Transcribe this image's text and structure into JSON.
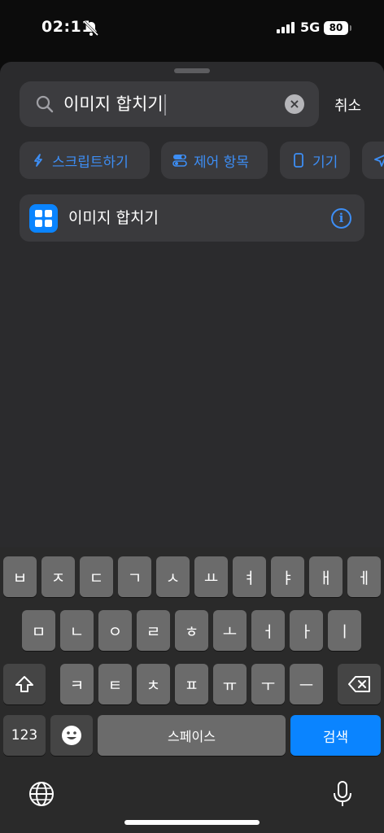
{
  "status": {
    "time": "02:11",
    "network": "5G",
    "battery": "80"
  },
  "search": {
    "query": "이미지 합치기",
    "clear_icon": "x-circle-icon",
    "cancel_label": "취소"
  },
  "chips": [
    {
      "label": "스크립트하기",
      "icon": "script-icon"
    },
    {
      "label": "제어 항목",
      "icon": "toggle-icon"
    },
    {
      "label": "기기",
      "icon": "phone-icon"
    },
    {
      "label": "",
      "icon": "location-arrow-icon"
    }
  ],
  "result": {
    "title": "이미지 합치기",
    "icon": "shortcut-app-icon",
    "info_icon": "info-icon"
  },
  "keyboard": {
    "row1": [
      "ㅂ",
      "ㅈ",
      "ㄷ",
      "ㄱ",
      "ㅅ",
      "ㅛ",
      "ㅕ",
      "ㅑ",
      "ㅐ",
      "ㅔ"
    ],
    "row2": [
      "ㅁ",
      "ㄴ",
      "ㅇ",
      "ㄹ",
      "ㅎ",
      "ㅗ",
      "ㅓ",
      "ㅏ",
      "ㅣ"
    ],
    "row3": [
      "ㅋ",
      "ㅌ",
      "ㅊ",
      "ㅍ",
      "ㅠ",
      "ㅜ",
      "ㅡ"
    ],
    "numbers_label": "123",
    "space_label": "스페이스",
    "search_label": "검색"
  },
  "colors": {
    "accent": "#0a84ff",
    "link": "#3d8ef5",
    "sheet": "#2b2b2d"
  }
}
